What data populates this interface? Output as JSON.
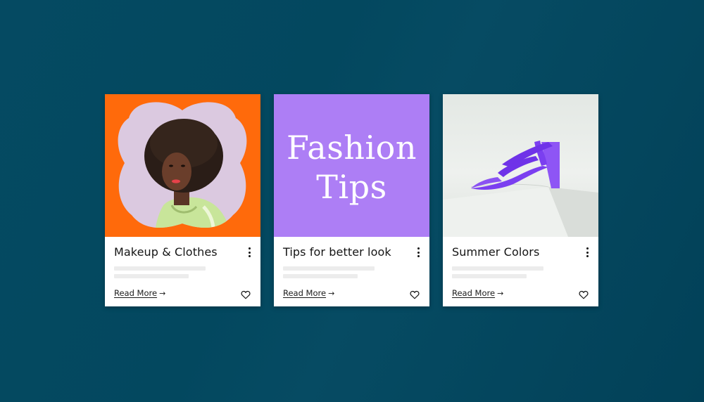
{
  "cards": [
    {
      "title": "Makeup & Clothes",
      "link": "Read More",
      "link_arrow": "→",
      "image": "woman-portrait",
      "background": "#ff6a0b"
    },
    {
      "title": "Tips for better look",
      "link": "Read More",
      "link_arrow": "→",
      "image_text_line1": "Fashion",
      "image_text_line2": "Tips",
      "background": "#ad7ef5"
    },
    {
      "title": "Summer Colors",
      "link": "Read More",
      "link_arrow": "→",
      "image": "purple-heel-sandal",
      "background": "#e6eae6"
    }
  ],
  "icons": {
    "menu": "more-vertical-icon",
    "like": "heart-icon",
    "arrow": "arrow-right-icon"
  },
  "colors": {
    "page_background": "#034a61",
    "accent_orange": "#ff6a0b",
    "accent_purple": "#ad7ef5",
    "shoe_purple": "#7b3ff0"
  }
}
